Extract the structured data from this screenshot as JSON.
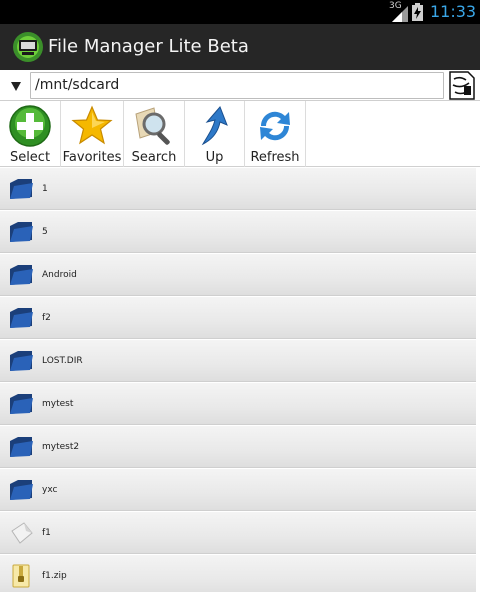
{
  "status_bar": {
    "network": "3G",
    "time": "11:33"
  },
  "action_bar": {
    "title": "File Manager Lite Beta",
    "app_icon": "app-logo-icon"
  },
  "path_bar": {
    "path": "/mnt/sdcard",
    "dropdown_icon": "dropdown-arrow-icon",
    "sd_icon": "sd-card-icon"
  },
  "toolbar": {
    "select_label": "Select",
    "favorites_label": "Favorites",
    "search_label": "Search",
    "up_label": "Up",
    "refresh_label": "Refresh"
  },
  "files": [
    {
      "name": "1",
      "type": "folder"
    },
    {
      "name": "5",
      "type": "folder"
    },
    {
      "name": "Android",
      "type": "folder"
    },
    {
      "name": "f2",
      "type": "folder"
    },
    {
      "name": "LOST.DIR",
      "type": "folder"
    },
    {
      "name": "mytest",
      "type": "folder"
    },
    {
      "name": "mytest2",
      "type": "folder"
    },
    {
      "name": "yxc",
      "type": "folder"
    },
    {
      "name": "f1",
      "type": "file"
    },
    {
      "name": "f1.zip",
      "type": "zip"
    }
  ],
  "colors": {
    "status_bg": "#000000",
    "clock": "#3aa7e8",
    "action_bar_bg": "#262626",
    "folder_blue": "#1f4f9e"
  }
}
